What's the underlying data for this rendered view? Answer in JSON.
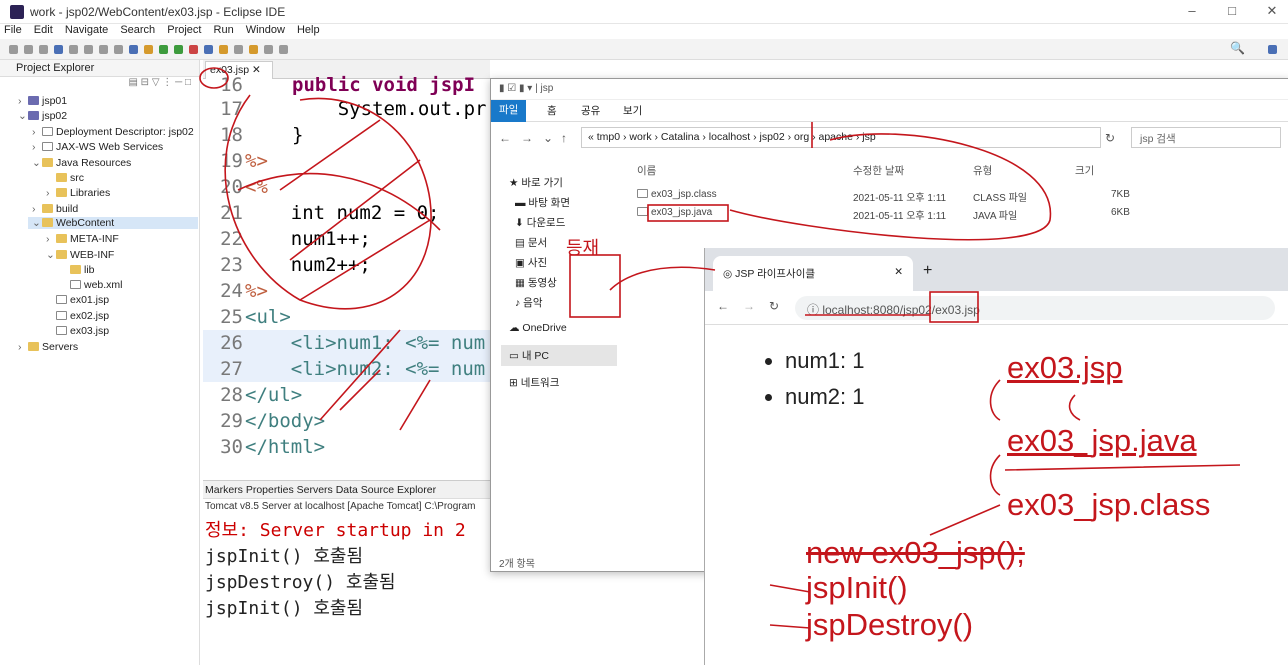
{
  "window": {
    "title": "work - jsp02/WebContent/ex03.jsp - Eclipse IDE"
  },
  "menu": [
    "File",
    "Edit",
    "Navigate",
    "Search",
    "Project",
    "Run",
    "Window",
    "Help"
  ],
  "explorer": {
    "title": "Project Explorer",
    "items": [
      {
        "label": "jsp01",
        "type": "project"
      },
      {
        "label": "jsp02",
        "type": "project"
      },
      {
        "label": "Deployment Descriptor: jsp02",
        "type": "node"
      },
      {
        "label": "JAX-WS Web Services",
        "type": "node"
      },
      {
        "label": "Java Resources",
        "type": "folder"
      },
      {
        "label": "src",
        "type": "folder"
      },
      {
        "label": "Libraries",
        "type": "folder"
      },
      {
        "label": "build",
        "type": "folder"
      },
      {
        "label": "WebContent",
        "type": "folder"
      },
      {
        "label": "META-INF",
        "type": "folder"
      },
      {
        "label": "WEB-INF",
        "type": "folder"
      },
      {
        "label": "lib",
        "type": "folder"
      },
      {
        "label": "web.xml",
        "type": "file"
      },
      {
        "label": "ex01.jsp",
        "type": "file"
      },
      {
        "label": "ex02.jsp",
        "type": "file"
      },
      {
        "label": "ex03.jsp",
        "type": "file"
      },
      {
        "label": "Servers",
        "type": "folder"
      }
    ]
  },
  "editor": {
    "tab": "ex03.jsp",
    "line_numbers": [
      "16",
      "17",
      "18",
      "19",
      "20",
      "21",
      "22",
      "23",
      "24",
      "25",
      "26",
      "27",
      "28",
      "29",
      "30"
    ],
    "lines": [
      "public void jspI",
      "    System.out.pr",
      "}",
      "%>",
      "<%",
      "",
      "    int num2 = 0;",
      "    num1++;",
      "    num2++;",
      "%>",
      "<ul>",
      "    <li>num1: <%= num",
      "    <li>num2: <%= num",
      "</ul>",
      "</body>",
      "</html>"
    ]
  },
  "console": {
    "tabs": "Markers  Properties  Servers  Data Source Explorer",
    "server": "Tomcat v8.5 Server at localhost [Apache Tomcat] C:\\Program",
    "lines": [
      "정보: Server startup in 2",
      "jspInit() 호출됨",
      "jspDestroy() 호출됨",
      "jspInit() 호출됨"
    ]
  },
  "file_explorer": {
    "path_title": "jsp",
    "ribbon": [
      "파일",
      "홈",
      "공유",
      "보기"
    ],
    "breadcrumb": "« tmp0 › work › Catalina › localhost › jsp02 › org › apache › jsp",
    "search_placeholder": "jsp 검색",
    "sidebar": [
      "바로 가기",
      "바탕 화면",
      "다운로드",
      "문서",
      "사진",
      "동영상",
      "음악",
      "OneDrive",
      "내 PC",
      "네트워크"
    ],
    "columns": [
      "이름",
      "수정한 날짜",
      "유형",
      "크기"
    ],
    "files": [
      {
        "name": "ex03_jsp.class",
        "date": "2021-05-11 오후 1:11",
        "type": "CLASS 파일",
        "size": "7KB"
      },
      {
        "name": "ex03_jsp.java",
        "date": "2021-05-11 오후 1:11",
        "type": "JAVA 파일",
        "size": "6KB"
      }
    ],
    "status": "2개 항목"
  },
  "browser": {
    "tab_title": "JSP 라이프사이클",
    "url": "localhost:8080/jsp02/ex03.jsp",
    "list": [
      "num1: 1",
      "num2: 1"
    ]
  },
  "annotations": {
    "handwritten": [
      "ex03.jsp",
      "ex03_jsp.java",
      "ex03_jsp.class",
      "new ex03_jsp();",
      "jspInit()",
      "jspDestroy()",
      "등재"
    ]
  }
}
